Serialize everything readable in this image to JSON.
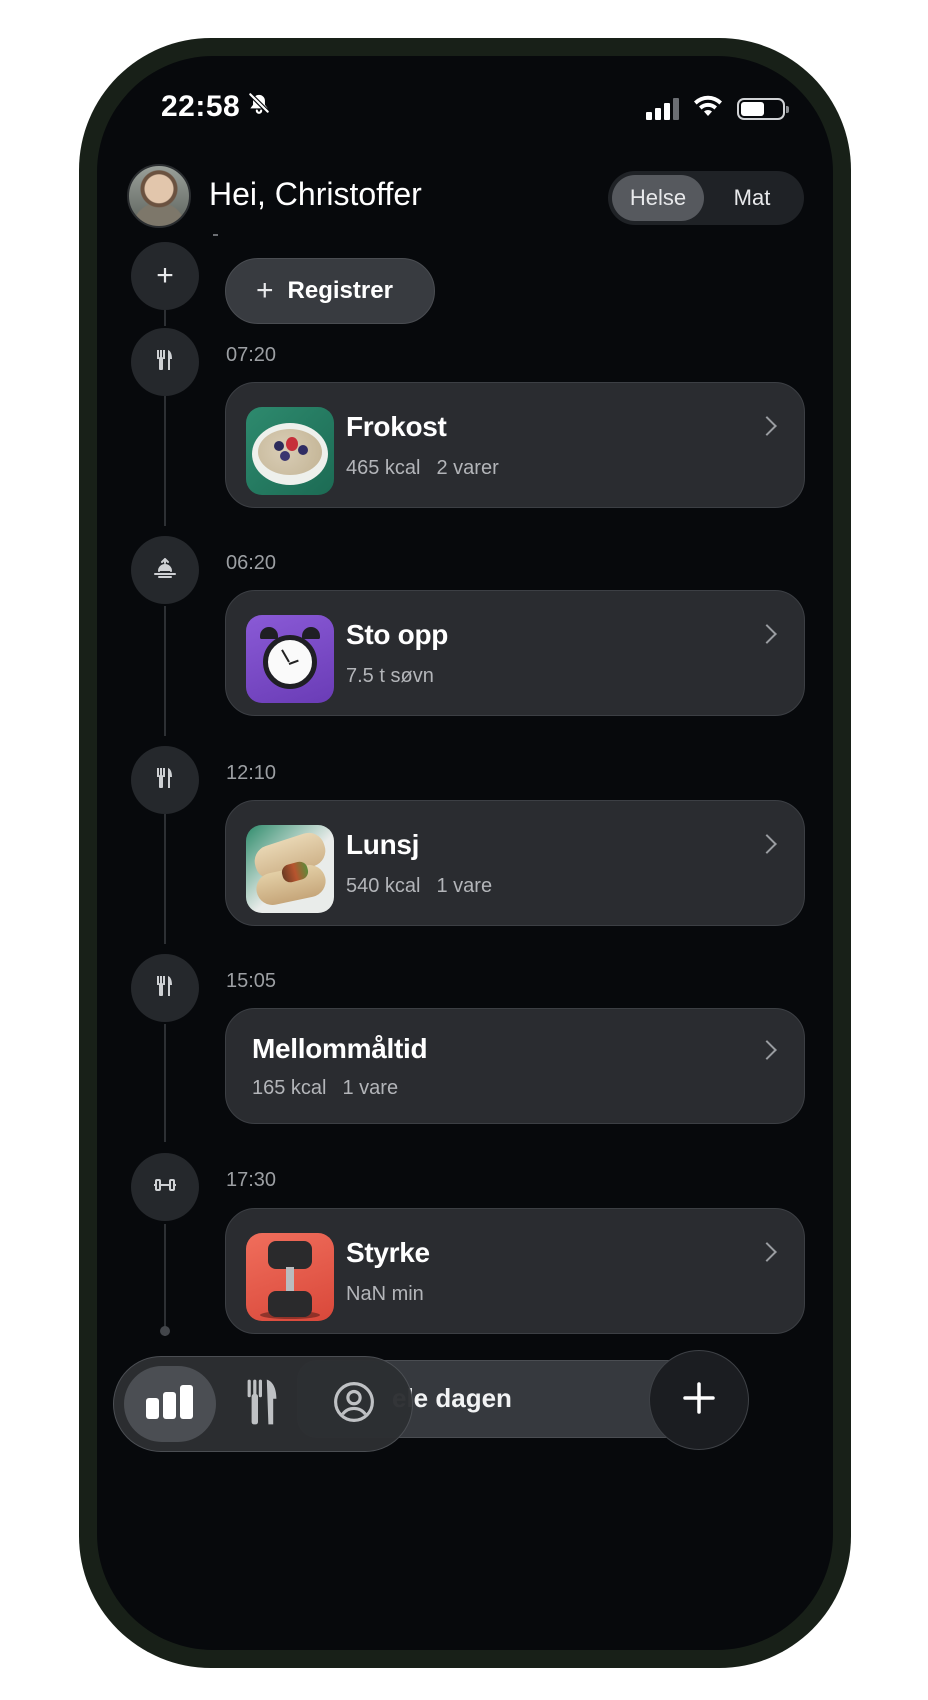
{
  "status_bar": {
    "time": "22:58"
  },
  "header": {
    "greeting": "Hei, Christoffer",
    "segments": [
      {
        "label": "Helse",
        "active": true
      },
      {
        "label": "Mat",
        "active": false
      }
    ]
  },
  "register_button": {
    "label": "Registrer"
  },
  "timeline": [
    {
      "time": "07:20",
      "icon": "fork-knife-icon",
      "title": "Frokost",
      "meta": [
        "465 kcal",
        "2 varer"
      ],
      "thumb": "oatmeal-bowl-image"
    },
    {
      "time": "06:20",
      "icon": "sunrise-icon",
      "title": "Sto opp",
      "meta": [
        "7.5 t søvn"
      ],
      "thumb": "alarm-clock-image"
    },
    {
      "time": "12:10",
      "icon": "fork-knife-icon",
      "title": "Lunsj",
      "meta": [
        "540 kcal",
        "1 vare"
      ],
      "thumb": "wrap-image"
    },
    {
      "time": "15:05",
      "icon": "fork-knife-icon",
      "title": "Mellommåltid",
      "meta": [
        "165 kcal",
        "1 vare"
      ],
      "thumb": null
    },
    {
      "time": "17:30",
      "icon": "dumbbell-icon",
      "title": "Styrke",
      "meta": [
        "NaN min"
      ],
      "thumb": "dumbbell-image"
    }
  ],
  "bottom": {
    "whole_day_label": "ele dagen",
    "tabs": [
      {
        "name": "stats-tab",
        "icon": "bar-chart-icon",
        "active": true
      },
      {
        "name": "food-tab",
        "icon": "fork-knife-icon",
        "active": false
      },
      {
        "name": "profile-tab",
        "icon": "profile-icon",
        "active": false
      }
    ]
  },
  "colors": {
    "background": "#07090c",
    "card": "#2a2c30",
    "frame": "#182018"
  }
}
